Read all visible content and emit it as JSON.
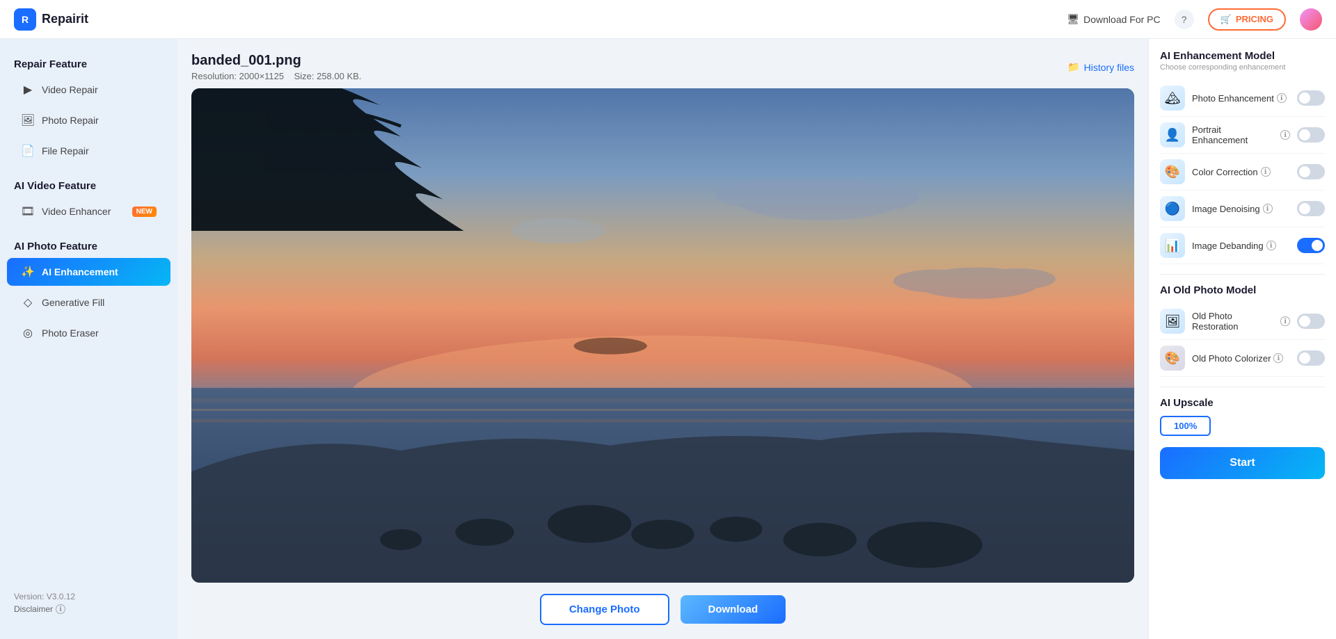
{
  "header": {
    "logo_text": "Repairit",
    "download_pc_label": "Download For PC",
    "pricing_label": "PRICING",
    "pricing_icon": "🛒"
  },
  "sidebar": {
    "repair_feature_title": "Repair Feature",
    "items_repair": [
      {
        "id": "video-repair",
        "label": "Video Repair",
        "icon": "▶"
      },
      {
        "id": "photo-repair",
        "label": "Photo Repair",
        "icon": "🖼"
      },
      {
        "id": "file-repair",
        "label": "File Repair",
        "icon": "📄"
      }
    ],
    "ai_video_title": "AI Video Feature",
    "items_ai_video": [
      {
        "id": "video-enhancer",
        "label": "Video Enhancer",
        "icon": "🎞",
        "badge": "NEW"
      }
    ],
    "ai_photo_title": "AI Photo Feature",
    "items_ai_photo": [
      {
        "id": "ai-enhancement",
        "label": "AI Enhancement",
        "icon": "✨",
        "active": true
      },
      {
        "id": "generative-fill",
        "label": "Generative Fill",
        "icon": "◇"
      },
      {
        "id": "photo-eraser",
        "label": "Photo Eraser",
        "icon": "◎"
      }
    ],
    "version": "Version: V3.0.12",
    "disclaimer": "Disclaimer"
  },
  "main": {
    "file_name": "banded_001.png",
    "resolution": "Resolution: 2000×1125",
    "size": "Size: 258.00 KB.",
    "history_files_label": "History files",
    "change_photo_label": "Change Photo",
    "download_label": "Download"
  },
  "right_panel": {
    "ai_enhancement_title": "AI Enhancement Model",
    "ai_enhancement_subtitle": "Choose corresponding enhancement",
    "features": [
      {
        "id": "photo-enhancement",
        "label": "Photo Enhancement",
        "active": false,
        "icon": "🏔"
      },
      {
        "id": "portrait-enhancement",
        "label": "Portrait Enhancement",
        "active": false,
        "icon": "👤"
      },
      {
        "id": "color-correction",
        "label": "Color Correction",
        "active": false,
        "icon": "🎨"
      },
      {
        "id": "image-denoising",
        "label": "Image Denoising",
        "active": false,
        "icon": "🔵"
      },
      {
        "id": "image-debanding",
        "label": "Image Debanding",
        "active": true,
        "icon": "📊"
      }
    ],
    "ai_old_photo_title": "AI Old Photo Model",
    "old_photo_features": [
      {
        "id": "old-photo-restoration",
        "label": "Old Photo Restoration",
        "active": false,
        "icon": "🖼"
      },
      {
        "id": "old-photo-colorizer",
        "label": "Old Photo Colorizer",
        "active": false,
        "icon": "🎨"
      }
    ],
    "ai_upscale_title": "AI Upscale",
    "upscale_option": "100%",
    "start_label": "Start"
  }
}
